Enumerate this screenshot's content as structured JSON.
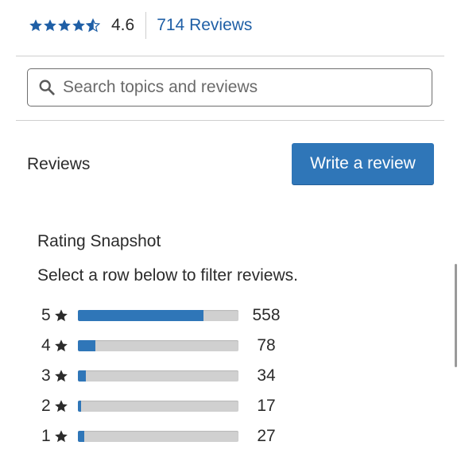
{
  "summary": {
    "average": "4.6",
    "average_value": 4.6,
    "review_count_label": "714 Reviews",
    "star_color": "#1f5fa6"
  },
  "search": {
    "placeholder": "Search topics and reviews",
    "value": "",
    "icon": "search-icon"
  },
  "reviews": {
    "heading": "Reviews",
    "write_button_label": "Write a review",
    "accent": "#2f76b8"
  },
  "snapshot": {
    "title": "Rating Snapshot",
    "subtitle": "Select a row below to filter reviews.",
    "rows": [
      {
        "stars": "5",
        "count": "558",
        "fraction": 0.78
      },
      {
        "stars": "4",
        "count": "78",
        "fraction": 0.11
      },
      {
        "stars": "3",
        "count": "34",
        "fraction": 0.05
      },
      {
        "stars": "2",
        "count": "17",
        "fraction": 0.02
      },
      {
        "stars": "1",
        "count": "27",
        "fraction": 0.04
      }
    ]
  }
}
